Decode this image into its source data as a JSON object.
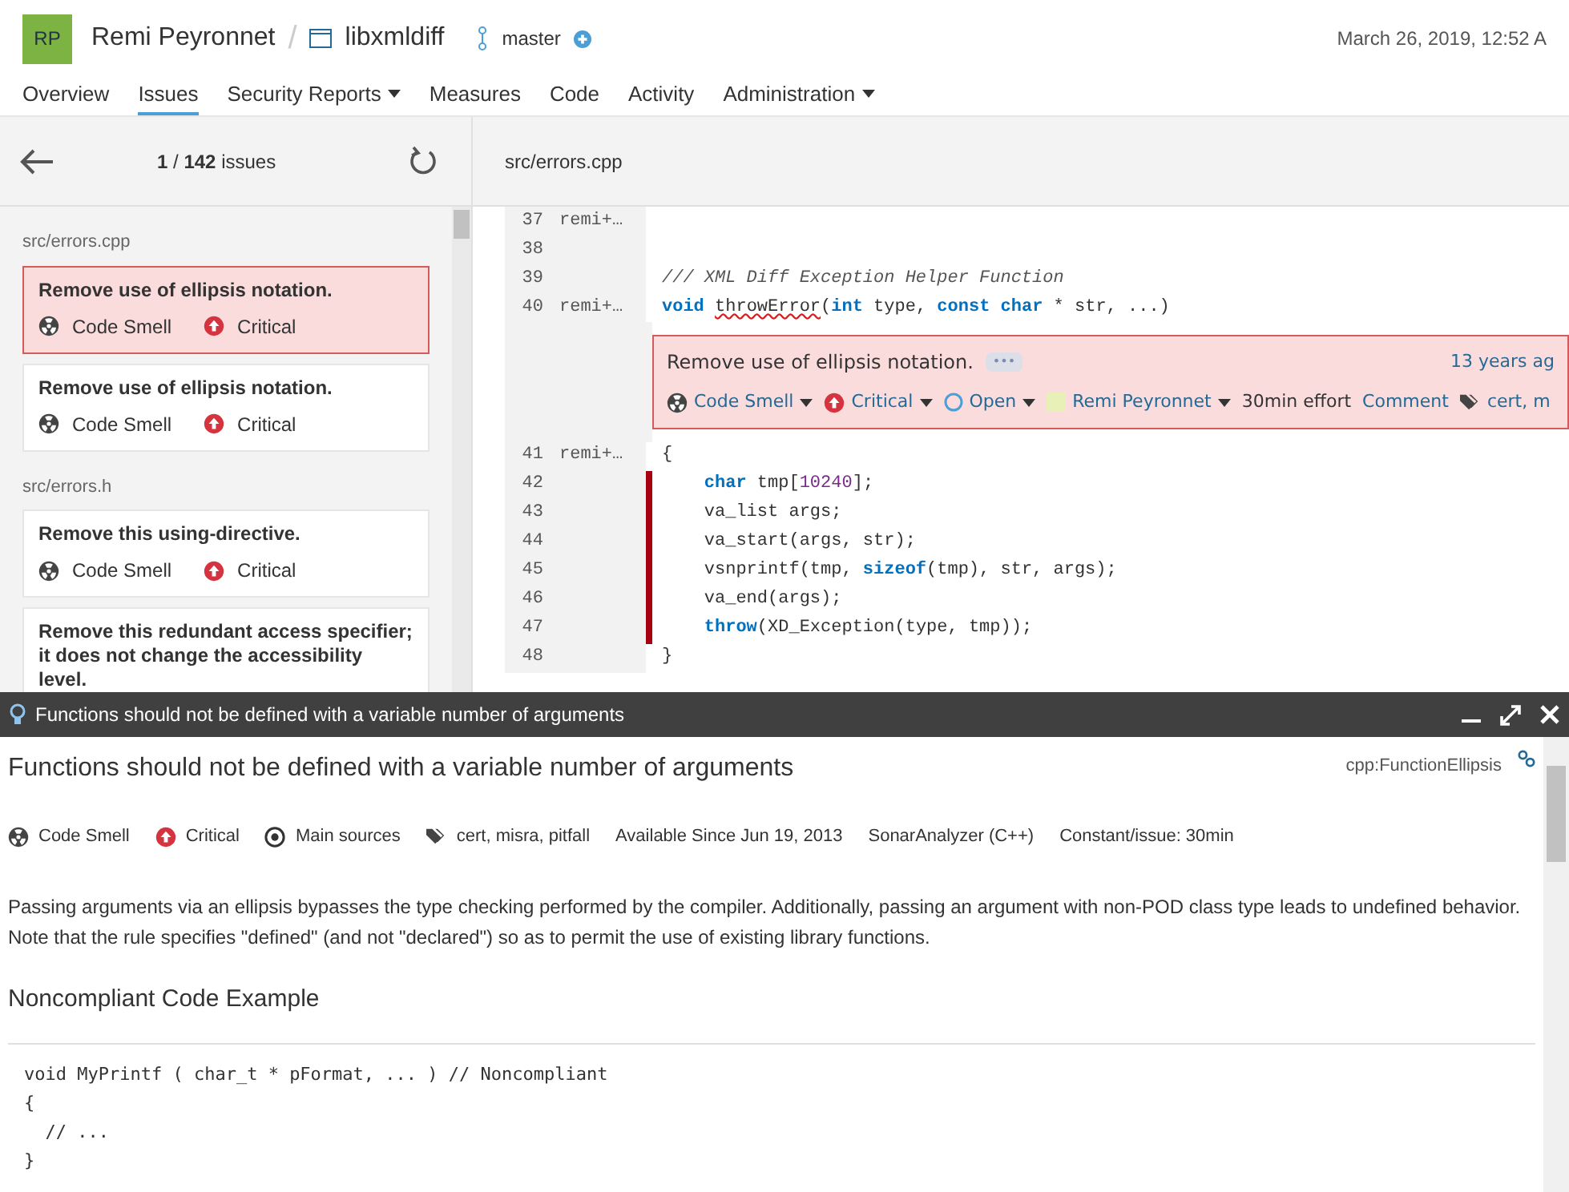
{
  "header": {
    "avatar": "RP",
    "owner": "Remi Peyronnet",
    "separator": "/",
    "project": "libxmldiff",
    "branch": "master",
    "date": "March 26, 2019, 12:52 A"
  },
  "nav": [
    {
      "label": "Overview",
      "selected": false,
      "dropdown": false
    },
    {
      "label": "Issues",
      "selected": true,
      "dropdown": false
    },
    {
      "label": "Security Reports",
      "selected": false,
      "dropdown": true
    },
    {
      "label": "Measures",
      "selected": false,
      "dropdown": false
    },
    {
      "label": "Code",
      "selected": false,
      "dropdown": false
    },
    {
      "label": "Activity",
      "selected": false,
      "dropdown": false
    },
    {
      "label": "Administration",
      "selected": false,
      "dropdown": true
    }
  ],
  "sidebar": {
    "counter": "**1** / **142** issues",
    "groups": [
      {
        "file": "src/errors.cpp",
        "issues": [
          {
            "title": "Remove use of ellipsis notation.",
            "type": "Code Smell",
            "severity": "Critical",
            "selected": true
          },
          {
            "title": "Remove use of ellipsis notation.",
            "type": "Code Smell",
            "severity": "Critical",
            "selected": false
          }
        ]
      },
      {
        "file": "src/errors.h",
        "issues": [
          {
            "title": "Remove this using-directive.",
            "type": "Code Smell",
            "severity": "Critical",
            "selected": false
          },
          {
            "title": "Remove this redundant access specifier; it does not change the accessibility level."
          }
        ]
      }
    ]
  },
  "code": {
    "file": "src/errors.cpp",
    "lines_before": [
      {
        "number": "37",
        "author": "remi+…",
        "flagged": false
      },
      {
        "number": "38",
        "flagged": false
      },
      {
        "number": "39",
        "flagged": false,
        "segments": [
          {
            "text": "/// XML Diff Exception Helper Function",
            "kind": "comment"
          }
        ]
      },
      {
        "number": "40",
        "author": "remi+…",
        "flagged": false,
        "segments": [
          {
            "text": "void ",
            "kind": "keyword"
          },
          {
            "text": "throwError",
            "kind": "squiggle"
          },
          {
            "text": "(",
            "kind": "plain"
          },
          {
            "text": "int",
            "kind": "keyword"
          },
          {
            "text": " type, ",
            "kind": "plain"
          },
          {
            "text": "const char",
            "kind": "keyword"
          },
          {
            "text": " * str, ...)",
            "kind": "plain"
          }
        ]
      }
    ],
    "issue": {
      "message": "Remove use of ellipsis notation.",
      "more": "•••",
      "age": "13 years ag",
      "type": "Code Smell",
      "severity": "Critical",
      "status": "Open",
      "assignee": "Remi Peyronnet",
      "effort": "30min effort",
      "comment": "Comment",
      "tags": "cert, m"
    },
    "lines_after": [
      {
        "number": "41",
        "author": "remi+…",
        "flagged": false,
        "segments": [
          {
            "text": "{",
            "kind": "plain"
          }
        ]
      },
      {
        "number": "42",
        "flagged": true,
        "segments": [
          {
            "text": "    char",
            "kind": "keyword"
          },
          {
            "text": " tmp[",
            "kind": "plain"
          },
          {
            "text": "10240",
            "kind": "number"
          },
          {
            "text": "];",
            "kind": "plain"
          }
        ]
      },
      {
        "number": "43",
        "flagged": true,
        "segments": [
          {
            "text": "    va_list args;",
            "kind": "plain"
          }
        ]
      },
      {
        "number": "44",
        "flagged": true,
        "segments": [
          {
            "text": "    va_start(args, str);",
            "kind": "plain"
          }
        ]
      },
      {
        "number": "45",
        "flagged": true,
        "segments": [
          {
            "text": "    vsnprintf(tmp, ",
            "kind": "plain"
          },
          {
            "text": "sizeof",
            "kind": "keyword"
          },
          {
            "text": "(tmp), str, args);",
            "kind": "plain"
          }
        ]
      },
      {
        "number": "46",
        "flagged": true,
        "segments": [
          {
            "text": "    va_end(args);",
            "kind": "plain"
          }
        ]
      },
      {
        "number": "47",
        "flagged": true,
        "segments": [
          {
            "text": "    throw",
            "kind": "keyword"
          },
          {
            "text": "(XD_Exception(type, tmp));",
            "kind": "plain"
          }
        ]
      },
      {
        "number": "48",
        "flagged": false,
        "segments": [
          {
            "text": "}",
            "kind": "plain"
          }
        ]
      }
    ]
  },
  "rule_panel": {
    "bar_title": "Functions should not be defined with a variable number of arguments",
    "title": "Functions should not be defined with a variable number of arguments",
    "key": "cpp:FunctionEllipsis",
    "meta": {
      "type": "Code Smell",
      "severity": "Critical",
      "scope": "Main sources",
      "tags": "cert, misra, pitfall",
      "since": "Available Since Jun 19, 2013",
      "analyzer": "SonarAnalyzer (C++)",
      "remediation": "Constant/issue: 30min"
    },
    "description": "Passing arguments via an ellipsis bypasses the type checking performed by the compiler. Additionally, passing an argument with non-POD class type leads to undefined behavior. Note that the rule specifies \"defined\" (and not \"declared\") so as to permit the use of existing library functions.",
    "section_title": "Noncompliant Code Example",
    "example": [
      "void MyPrintf ( char_t * pFormat, ... ) // Noncompliant",
      "{",
      "  // ...",
      "}"
    ]
  }
}
